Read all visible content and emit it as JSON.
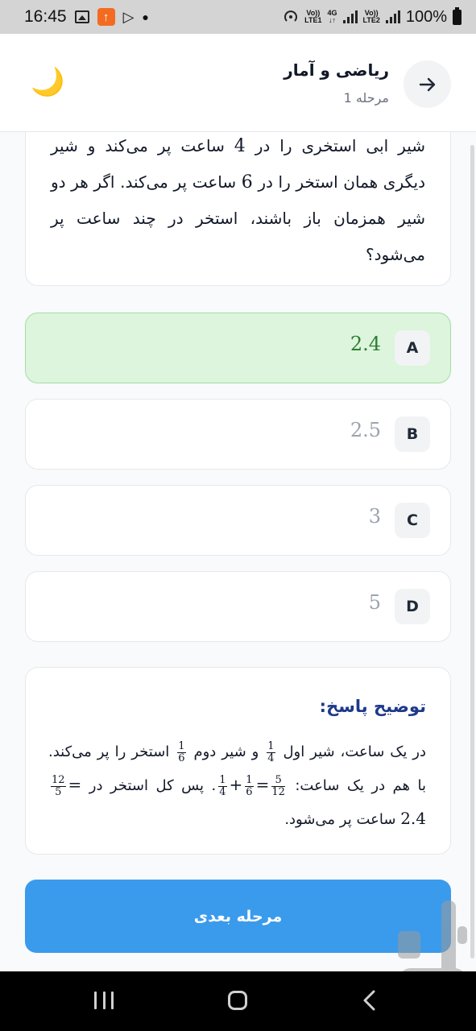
{
  "status_bar": {
    "time": "16:45",
    "net_label_1": "Vo))",
    "net_label_1b": "LTE1",
    "net_label_4g": "4G",
    "net_label_2": "Vo))",
    "net_label_2b": "LTE2",
    "battery": "100%"
  },
  "header": {
    "title": "ریاضی و آمار",
    "subtitle": "مرحله 1",
    "moon_icon": "🌙"
  },
  "question": {
    "line1_pre": "شیر ابی استخری را در ",
    "n1": "4",
    "line1_post": " ساعت پر می‌کند و شیر دیگری همان استخر را در ",
    "n2": "6",
    "line2_post": " ساعت پر می‌کند. اگر هر دو شیر همزمان باز باشند، استخر در چند ساعت پر می‌شود؟"
  },
  "options": [
    {
      "letter": "A",
      "value": "2.4",
      "state": "correct"
    },
    {
      "letter": "B",
      "value": "2.5",
      "state": "normal"
    },
    {
      "letter": "C",
      "value": "3",
      "state": "normal"
    },
    {
      "letter": "D",
      "value": "5",
      "state": "normal"
    }
  ],
  "explanation": {
    "title": "توضیح پاسخ:",
    "t1": "در یک ساعت، شیر اول",
    "f1_num": "1",
    "f1_den": "4",
    "t2": "و شیر دوم",
    "f2_num": "1",
    "f2_den": "6",
    "t3": "استخر را پر می‌کند. با هم در یک ساعت:",
    "f3_num": "1",
    "f3_den": "4",
    "plus": "+",
    "f4_num": "1",
    "f4_den": "6",
    "eq1": "=",
    "f5_num": "5",
    "f5_den": "12",
    "t4": ". پس کل استخر در",
    "f6_num": "12",
    "f6_den": "5",
    "eq2": "= 2.4",
    "t5": "ساعت پر می‌شود."
  },
  "next_button": {
    "label": "مرحله بعدی"
  },
  "colors": {
    "accent": "#3a9bec",
    "correct_bg": "#dcf5dc",
    "correct_text": "#2e7d32",
    "explanation_title": "#1e3a8a"
  },
  "icons": {
    "back": "arrow-right-icon",
    "theme": "moon-icon",
    "watermark": "app-logo-icon"
  }
}
